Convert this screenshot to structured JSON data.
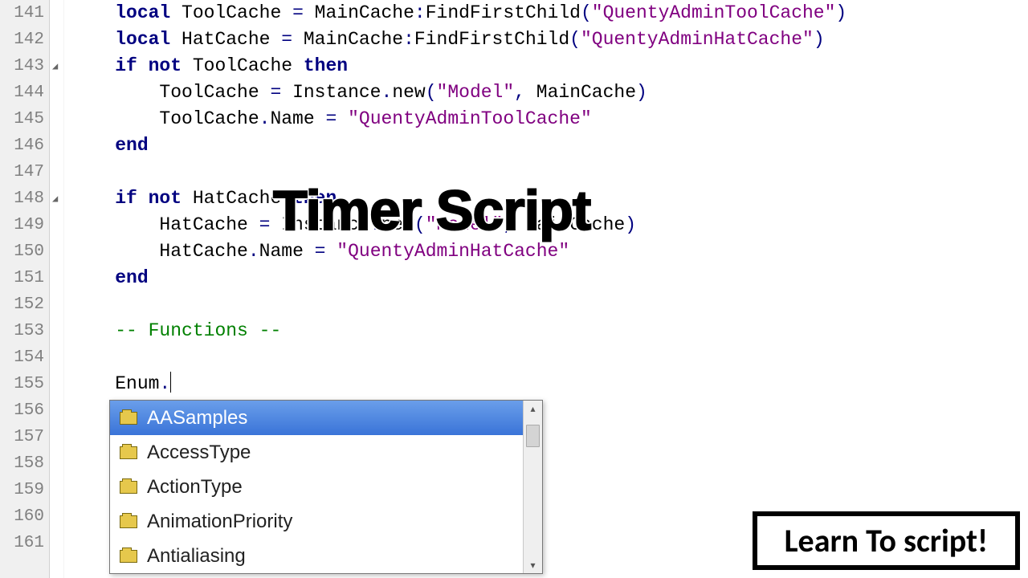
{
  "gutter": {
    "start": 141,
    "end": 161
  },
  "fold_marks": [
    143,
    148
  ],
  "code_lines": [
    {
      "n": 141,
      "segments": [
        {
          "t": "    ",
          "c": ""
        },
        {
          "t": "local",
          "c": "kw"
        },
        {
          "t": " ToolCache ",
          "c": "id"
        },
        {
          "t": "=",
          "c": "op"
        },
        {
          "t": " MainCache",
          "c": "id"
        },
        {
          "t": ":",
          "c": "op"
        },
        {
          "t": "FindFirstChild",
          "c": "fn"
        },
        {
          "t": "(",
          "c": "op"
        },
        {
          "t": "\"QuentyAdminToolCache\"",
          "c": "str"
        },
        {
          "t": ")",
          "c": "op"
        }
      ]
    },
    {
      "n": 142,
      "segments": [
        {
          "t": "    ",
          "c": ""
        },
        {
          "t": "local",
          "c": "kw"
        },
        {
          "t": " HatCache ",
          "c": "id"
        },
        {
          "t": "=",
          "c": "op"
        },
        {
          "t": " MainCache",
          "c": "id"
        },
        {
          "t": ":",
          "c": "op"
        },
        {
          "t": "FindFirstChild",
          "c": "fn"
        },
        {
          "t": "(",
          "c": "op"
        },
        {
          "t": "\"QuentyAdminHatCache\"",
          "c": "str"
        },
        {
          "t": ")",
          "c": "op"
        }
      ]
    },
    {
      "n": 143,
      "segments": [
        {
          "t": "    ",
          "c": ""
        },
        {
          "t": "if not",
          "c": "kw"
        },
        {
          "t": " ToolCache ",
          "c": "id"
        },
        {
          "t": "then",
          "c": "kw"
        }
      ]
    },
    {
      "n": 144,
      "segments": [
        {
          "t": "        ToolCache ",
          "c": "id"
        },
        {
          "t": "=",
          "c": "op"
        },
        {
          "t": " Instance",
          "c": "id"
        },
        {
          "t": ".",
          "c": "op"
        },
        {
          "t": "new",
          "c": "fn"
        },
        {
          "t": "(",
          "c": "op"
        },
        {
          "t": "\"Model\"",
          "c": "str"
        },
        {
          "t": ",",
          "c": "op"
        },
        {
          "t": " MainCache",
          "c": "id"
        },
        {
          "t": ")",
          "c": "op"
        }
      ]
    },
    {
      "n": 145,
      "segments": [
        {
          "t": "        ToolCache",
          "c": "id"
        },
        {
          "t": ".",
          "c": "op"
        },
        {
          "t": "Name ",
          "c": "id"
        },
        {
          "t": "=",
          "c": "op"
        },
        {
          "t": " ",
          "c": ""
        },
        {
          "t": "\"QuentyAdminToolCache\"",
          "c": "str"
        }
      ]
    },
    {
      "n": 146,
      "segments": [
        {
          "t": "    ",
          "c": ""
        },
        {
          "t": "end",
          "c": "kw"
        }
      ]
    },
    {
      "n": 147,
      "segments": []
    },
    {
      "n": 148,
      "segments": [
        {
          "t": "    ",
          "c": ""
        },
        {
          "t": "if not",
          "c": "kw"
        },
        {
          "t": " HatCache ",
          "c": "id"
        },
        {
          "t": "then",
          "c": "kw"
        }
      ]
    },
    {
      "n": 149,
      "segments": [
        {
          "t": "        HatCache ",
          "c": "id"
        },
        {
          "t": "=",
          "c": "op"
        },
        {
          "t": " Instance",
          "c": "id"
        },
        {
          "t": ".",
          "c": "op"
        },
        {
          "t": "new",
          "c": "fn"
        },
        {
          "t": "(",
          "c": "op"
        },
        {
          "t": "\"Model\"",
          "c": "str"
        },
        {
          "t": ",",
          "c": "op"
        },
        {
          "t": " MainCache",
          "c": "id"
        },
        {
          "t": ")",
          "c": "op"
        }
      ]
    },
    {
      "n": 150,
      "segments": [
        {
          "t": "        HatCache",
          "c": "id"
        },
        {
          "t": ".",
          "c": "op"
        },
        {
          "t": "Name ",
          "c": "id"
        },
        {
          "t": "=",
          "c": "op"
        },
        {
          "t": " ",
          "c": ""
        },
        {
          "t": "\"QuentyAdminHatCache\"",
          "c": "str"
        }
      ]
    },
    {
      "n": 151,
      "segments": [
        {
          "t": "    ",
          "c": ""
        },
        {
          "t": "end",
          "c": "kw"
        }
      ]
    },
    {
      "n": 152,
      "segments": []
    },
    {
      "n": 153,
      "segments": [
        {
          "t": "    ",
          "c": ""
        },
        {
          "t": "-- Functions --",
          "c": "cmt"
        }
      ]
    },
    {
      "n": 154,
      "segments": []
    },
    {
      "n": 155,
      "segments": [
        {
          "t": "    Enum",
          "c": "id"
        },
        {
          "t": ".",
          "c": "op"
        }
      ],
      "caret": true
    },
    {
      "n": 156,
      "segments": []
    },
    {
      "n": 157,
      "segments": []
    },
    {
      "n": 158,
      "segments": []
    },
    {
      "n": 159,
      "segments": []
    },
    {
      "n": 160,
      "segments": []
    },
    {
      "n": 161,
      "segments": []
    }
  ],
  "autocomplete": {
    "items": [
      "AASamples",
      "AccessType",
      "ActionType",
      "AnimationPriority",
      "Antialiasing"
    ],
    "selected_index": 0
  },
  "overlay": {
    "title": "Timer Script",
    "learn": "Learn To script!"
  }
}
